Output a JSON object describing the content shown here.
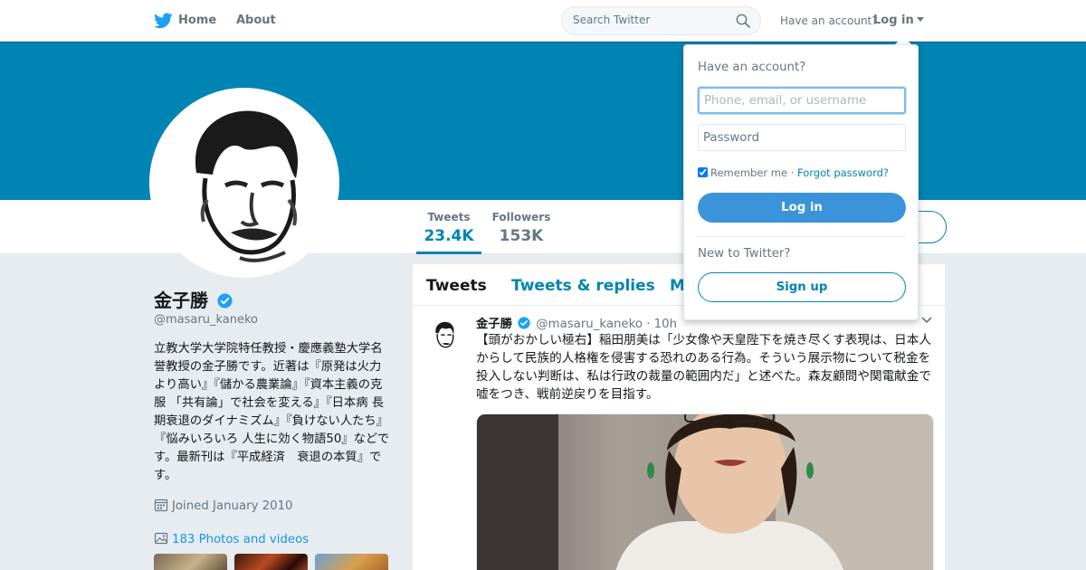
{
  "nav": {
    "home_label": "Home",
    "about_label": "About",
    "search_placeholder": "Search Twitter",
    "have_account": "Have an account?",
    "login_label": "Log in"
  },
  "colors": {
    "brand": "#0084b4",
    "banner": "#0084b4",
    "login_button": "#3b94d9",
    "link": "#1b95e0"
  },
  "profile": {
    "name": "金子勝",
    "screen_name": "@masaru_kaneko",
    "verified": true,
    "bio": "立教大学大学院特任教授・慶應義塾大学名誉教授の金子勝です。近著は『原発は火力より高い』『儲かる農業論』『資本主義の克服 「共有論」で社会を変える』『日本病 長期衰退のダイナミズム』『負けない人たち』『悩みいろいろ 人生に効く物語50』などです。最新刊は『平成経済　衰退の本質』です。",
    "joined": "Joined January 2010",
    "photos_label": "183 Photos and videos"
  },
  "stats": [
    {
      "label": "Tweets",
      "value": "23.4K"
    },
    {
      "label": "Followers",
      "value": "153K"
    }
  ],
  "timeline": {
    "tabs": [
      "Tweets",
      "Tweets & replies",
      "M"
    ],
    "tweet": {
      "fullname": "金子勝",
      "username": "@masaru_kaneko",
      "separator": "·",
      "time": "10h",
      "text": "【頭がおかしい極右】稲田朋美は「少女像や天皇陛下を焼き尽くす表現は、日本人からして民族的人格権を侵害する恐れのある行為。そういう展示物について税金を投入しない判断は、私は行政の裁量の範囲内だ」と述べた。森友顧問や関電献金で嘘をつき、戦前逆戻りを目指す。"
    }
  },
  "login_dropdown": {
    "title": "Have an account?",
    "username_placeholder": "Phone, email, or username",
    "password_placeholder": "Password",
    "remember_label": "Remember me",
    "separator": "·",
    "forgot_label": "Forgot password?",
    "login_button": "Log in",
    "new_to": "New to Twitter?",
    "signup_button": "Sign up"
  }
}
